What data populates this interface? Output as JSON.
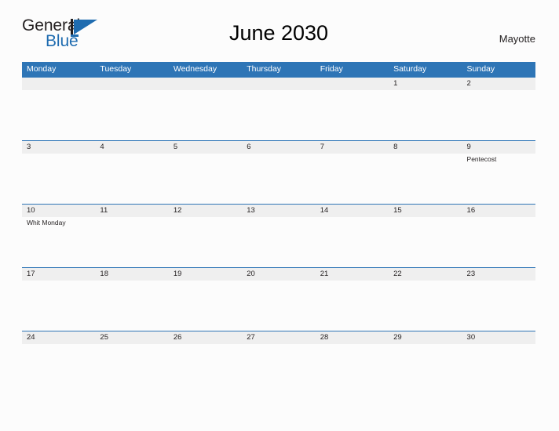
{
  "brand": {
    "name_part1": "General",
    "name_part2": "Blue",
    "mark_icon": "triangle-flag-icon"
  },
  "header": {
    "title": "June 2030",
    "locale": "Mayotte"
  },
  "colors": {
    "header_blue": "#2e75b6",
    "band_gray": "#efefef",
    "brand_blue": "#1f6cb0",
    "page_background": "#fcfcfc",
    "text": "#231f20"
  },
  "calendar": {
    "weekdays": [
      "Monday",
      "Tuesday",
      "Wednesday",
      "Thursday",
      "Friday",
      "Saturday",
      "Sunday"
    ],
    "weeks": [
      [
        {
          "day": ""
        },
        {
          "day": ""
        },
        {
          "day": ""
        },
        {
          "day": ""
        },
        {
          "day": ""
        },
        {
          "day": "1"
        },
        {
          "day": "2"
        }
      ],
      [
        {
          "day": "3"
        },
        {
          "day": "4"
        },
        {
          "day": "5"
        },
        {
          "day": "6"
        },
        {
          "day": "7"
        },
        {
          "day": "8"
        },
        {
          "day": "9",
          "event": "Pentecost"
        }
      ],
      [
        {
          "day": "10",
          "event": "Whit Monday"
        },
        {
          "day": "11"
        },
        {
          "day": "12"
        },
        {
          "day": "13"
        },
        {
          "day": "14"
        },
        {
          "day": "15"
        },
        {
          "day": "16"
        }
      ],
      [
        {
          "day": "17"
        },
        {
          "day": "18"
        },
        {
          "day": "19"
        },
        {
          "day": "20"
        },
        {
          "day": "21"
        },
        {
          "day": "22"
        },
        {
          "day": "23"
        }
      ],
      [
        {
          "day": "24"
        },
        {
          "day": "25"
        },
        {
          "day": "26"
        },
        {
          "day": "27"
        },
        {
          "day": "28"
        },
        {
          "day": "29"
        },
        {
          "day": "30"
        }
      ]
    ]
  }
}
